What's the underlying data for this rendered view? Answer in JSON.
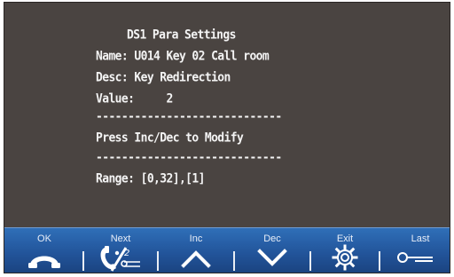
{
  "screen": {
    "title": "DS1 Para Settings",
    "name_line": "Name: U014 Key 02 Call room",
    "desc_line": "Desc: Key Redirection",
    "value_line": "Value:     2",
    "separator_1": "-----------------------------",
    "instruction": "Press Inc/Dec to Modify",
    "separator_2": "-----------------------------",
    "range_line": "Range: [0,32],[1]"
  },
  "softkeys": [
    {
      "label": "OK",
      "icon": "handset-icon"
    },
    {
      "label": "Next",
      "icon": "call-forward-icon"
    },
    {
      "label": "Inc",
      "icon": "chevron-up-icon"
    },
    {
      "label": "Dec",
      "icon": "chevron-down-icon"
    },
    {
      "label": "Exit",
      "icon": "gear-icon"
    },
    {
      "label": "Last",
      "icon": "key-icon"
    }
  ],
  "colors": {
    "lcd_background": "#4a4441",
    "lcd_text": "#f4f4f4",
    "softkey_bar": "#22549a"
  }
}
